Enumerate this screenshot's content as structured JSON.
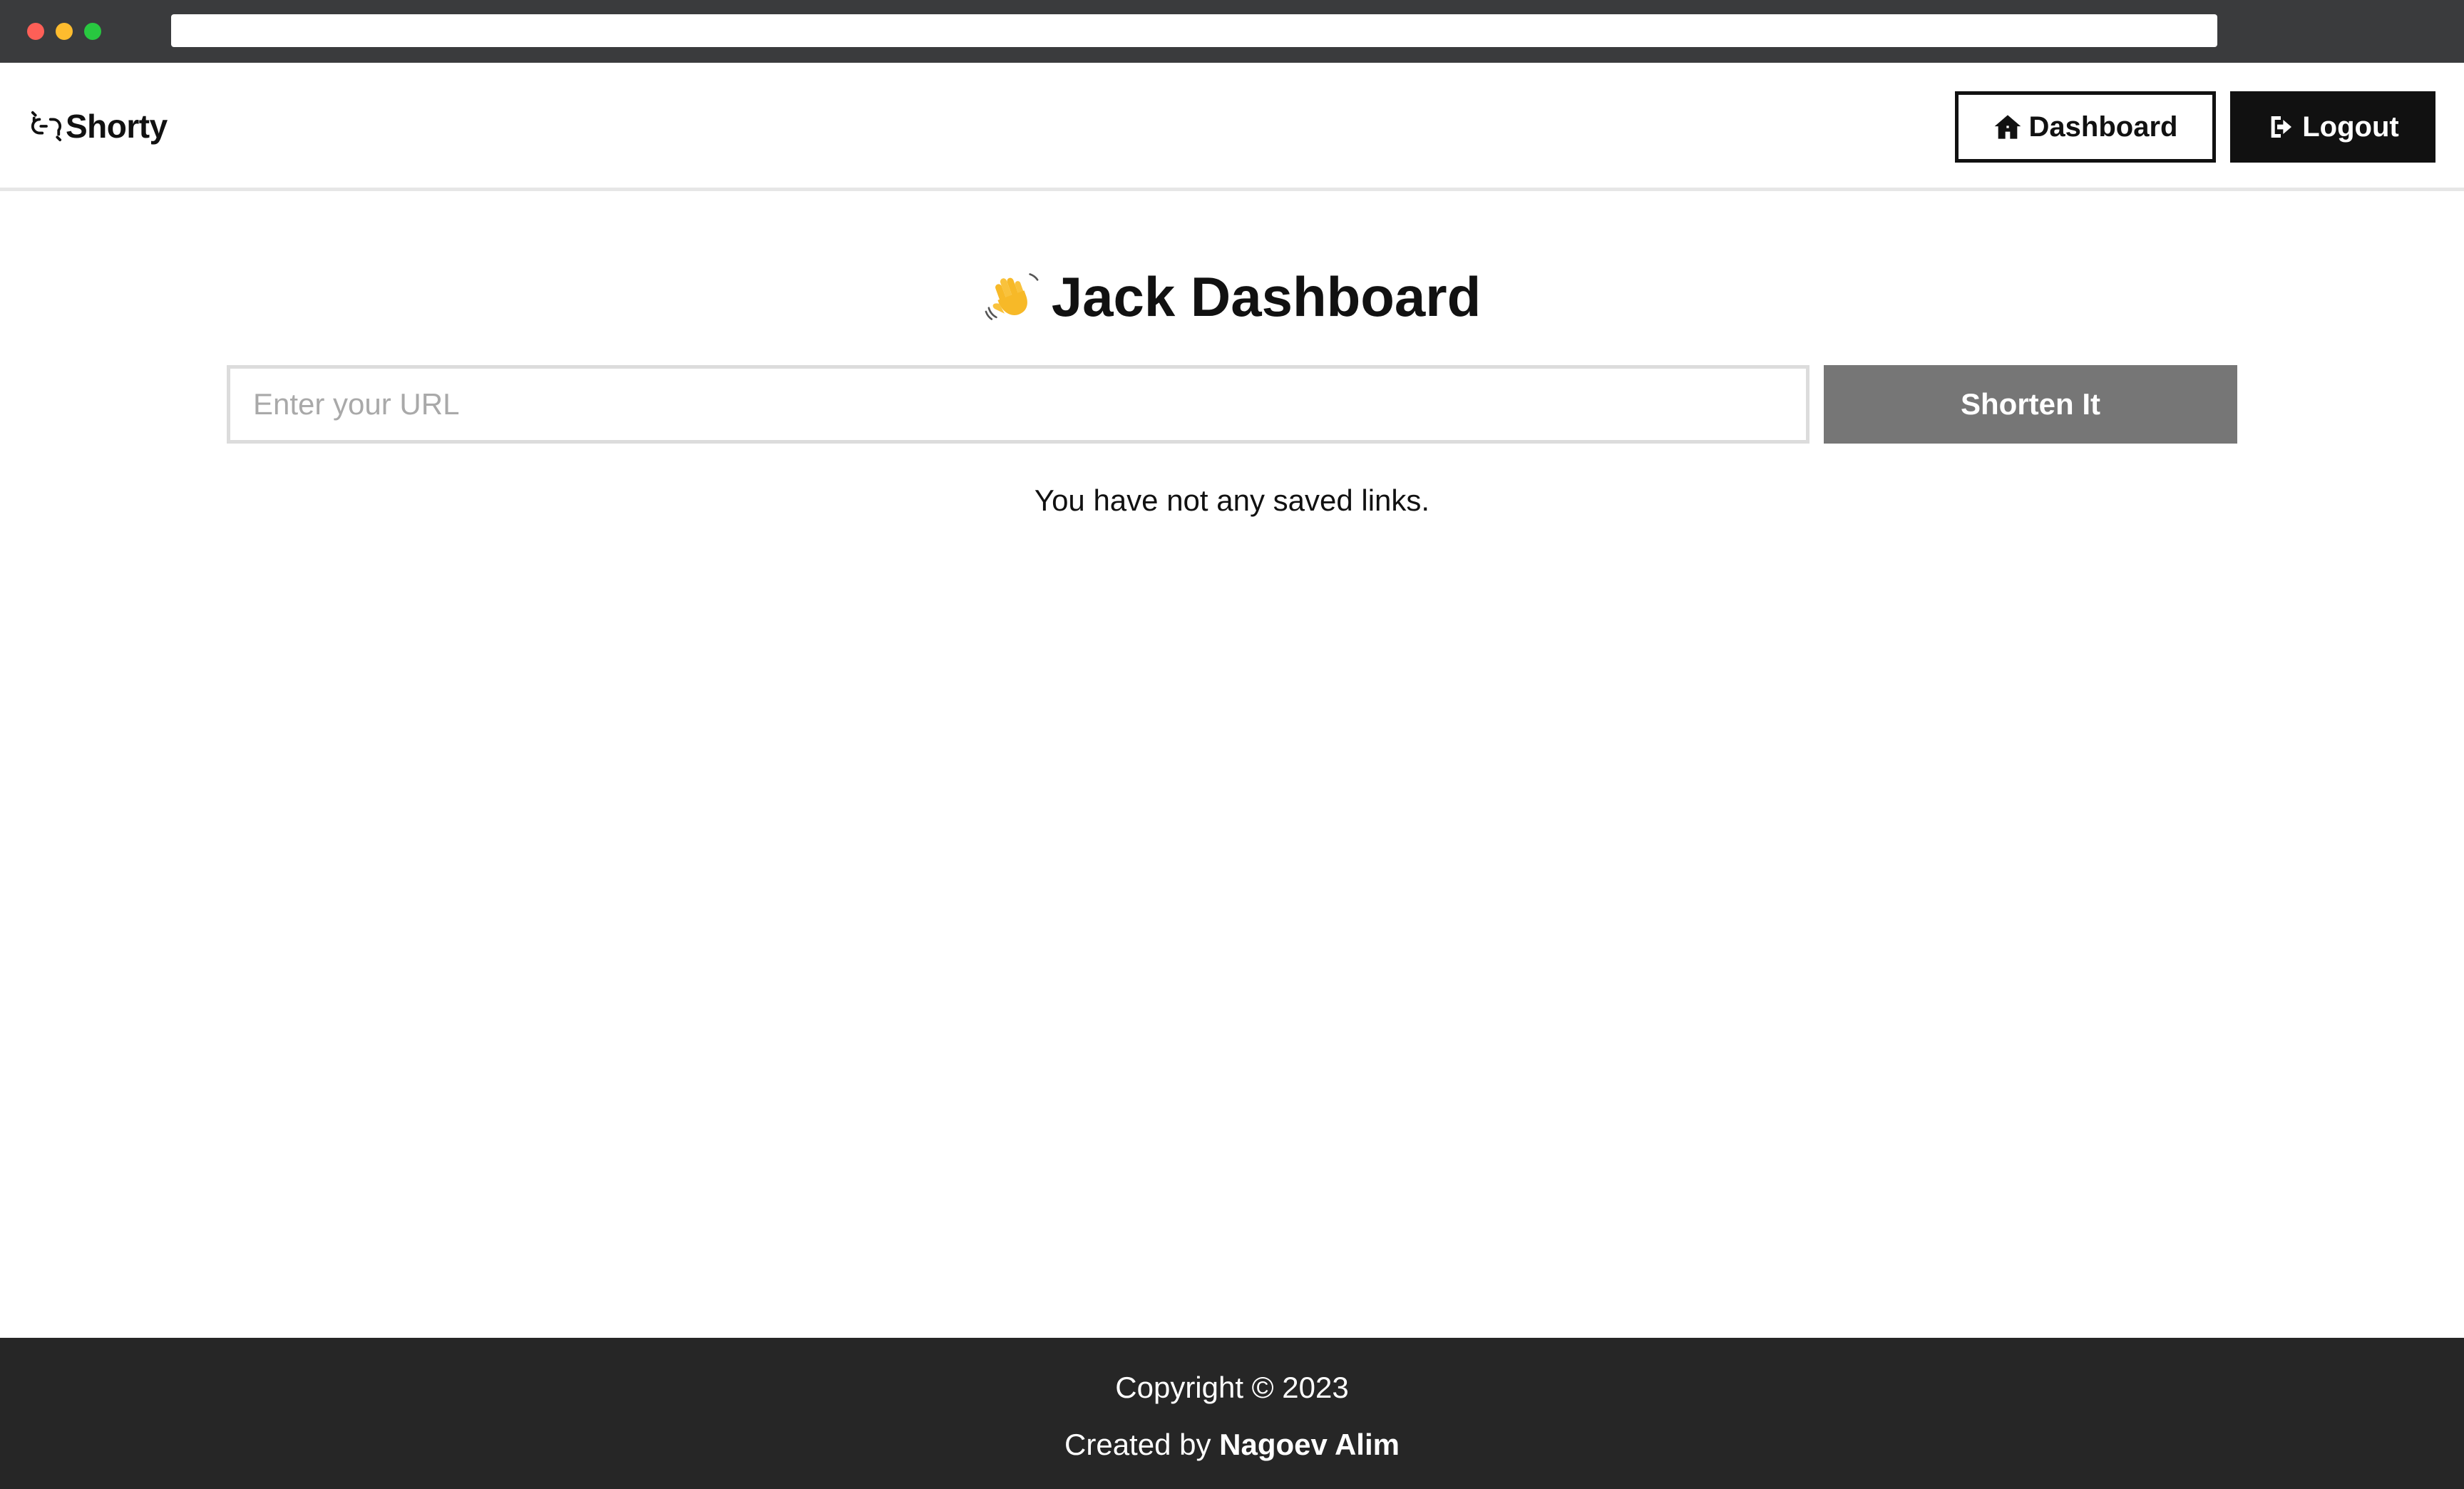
{
  "header": {
    "logo_text": "Shorty",
    "logo_icon": "broken-link-icon",
    "dashboard_label": "Dashboard",
    "dashboard_icon": "house-icon",
    "logout_label": "Logout",
    "logout_icon": "logout-arrow-icon"
  },
  "main": {
    "title_emoji_icon": "waving-hand-icon",
    "title": "Jack Dashboard",
    "url_placeholder": "Enter your URL",
    "url_value": "",
    "shorten_label": "Shorten It",
    "empty_message": "You have not any saved links."
  },
  "footer": {
    "copyright": "Copyright © 2023",
    "created_by_prefix": "Created by",
    "author": "Nagoev Alim"
  },
  "colors": {
    "footer_bg": "#262626",
    "primary_dark": "#111111",
    "shorten_button_bg": "#767676",
    "input_border": "#dcdcdc",
    "browser_bar": "#3a3b3d"
  }
}
